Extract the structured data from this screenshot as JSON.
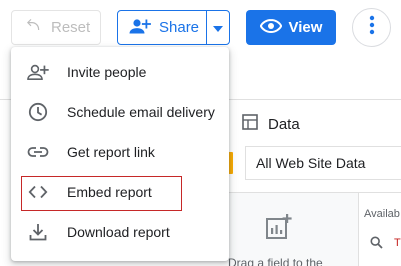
{
  "toolbar": {
    "reset_label": "Reset",
    "share_label": "Share",
    "view_label": "View"
  },
  "share_menu": {
    "items": [
      {
        "label": "Invite people",
        "icon": "person-add-icon"
      },
      {
        "label": "Schedule email delivery",
        "icon": "clock-icon"
      },
      {
        "label": "Get report link",
        "icon": "link-icon"
      },
      {
        "label": "Embed report",
        "icon": "code-icon",
        "highlighted": true
      },
      {
        "label": "Download report",
        "icon": "download-icon"
      }
    ]
  },
  "data_panel": {
    "title": "Data",
    "data_source": "All Web Site Data",
    "drop_hint": "Drag a field to the",
    "available_label": "Availab",
    "search_partial": "T"
  },
  "colors": {
    "accent": "#1a73e8",
    "highlight_border": "#c62828",
    "data_source_bar": "#f9ab00"
  }
}
